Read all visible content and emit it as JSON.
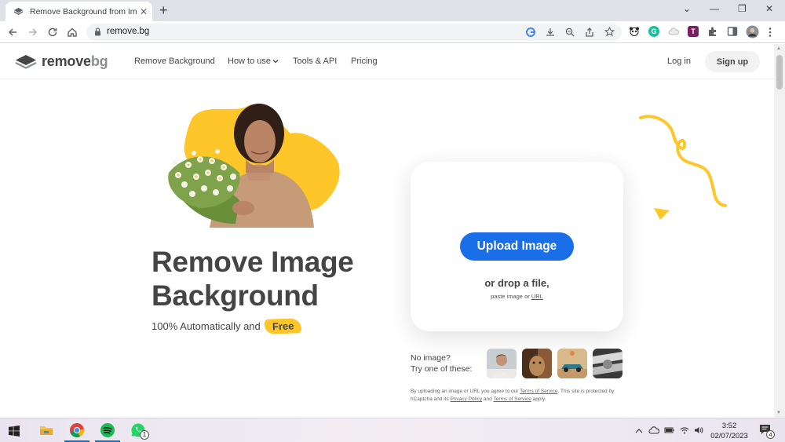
{
  "browser": {
    "tab_title": "Remove Background from Image",
    "url": "remove.bg",
    "new_tab_symbol": "+",
    "tab_close_symbol": "✕",
    "window_minimize": "—",
    "window_restore": "❐",
    "window_close": "✕",
    "tab_list_symbol": "⌄"
  },
  "header": {
    "logo_main": "remove",
    "logo_accent": "bg",
    "nav": [
      "Remove Background",
      "How to use",
      "Tools & API",
      "Pricing"
    ],
    "login": "Log in",
    "signup": "Sign up"
  },
  "hero": {
    "headline_line1": "Remove Image",
    "headline_line2": "Background",
    "subline": "100% Automatically and",
    "free_badge": "Free"
  },
  "upload": {
    "button": "Upload Image",
    "drop_text": "or drop a file,",
    "paste_prefix": "paste image or",
    "paste_link": "URL"
  },
  "samples": {
    "line1": "No image?",
    "line2": "Try one of these:"
  },
  "terms": {
    "t1": "By uploading an image or URL you agree to our",
    "link1": "Terms of Service",
    "t2": ". This site is protected by hCaptcha and its",
    "link2": "Privacy Policy",
    "t3": "and",
    "link3": "Terms of Service",
    "t4": "apply."
  },
  "taskbar": {
    "time": "3:52",
    "date": "02/07/2023",
    "whatsapp_badge": "1",
    "notification_badge": "4"
  },
  "colors": {
    "accent_blue": "#1a6fe8",
    "brand_yellow": "#ffc629",
    "text_dark": "#454545"
  },
  "icons": [
    "back-arrow-icon",
    "forward-arrow-icon",
    "reload-icon",
    "home-icon",
    "lock-icon",
    "google-icon",
    "download-icon",
    "zoom-icon",
    "share-icon",
    "star-icon",
    "extensions-icon",
    "sidepanel-icon",
    "profile-avatar",
    "more-icon",
    "windows-start-icon",
    "file-explorer-icon",
    "chrome-icon",
    "spotify-icon",
    "whatsapp-icon"
  ]
}
